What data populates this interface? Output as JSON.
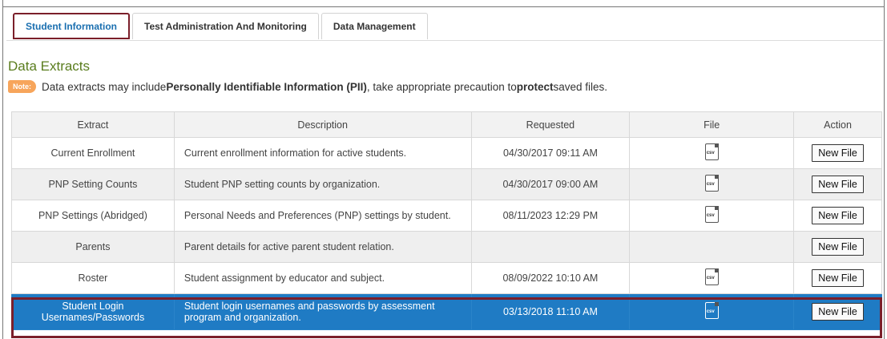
{
  "tabs": [
    {
      "label": "Student Information"
    },
    {
      "label": "Test Administration And Monitoring"
    },
    {
      "label": "Data Management"
    }
  ],
  "section_title": "Data Extracts",
  "note": {
    "badge": "Note:",
    "text_1": "Data extracts may include ",
    "bold_1": "Personally Identifiable Information (PII)",
    "text_2": ", take appropriate precaution to ",
    "bold_2": "protect",
    "text_3": " saved files."
  },
  "table": {
    "headers": {
      "extract": "Extract",
      "description": "Description",
      "requested": "Requested",
      "file": "File",
      "action": "Action"
    },
    "button_label": "New File",
    "file_icon_text": "csv",
    "rows": [
      {
        "extract": "Current Enrollment",
        "description": "Current enrollment information for active students.",
        "requested": "04/30/2017 09:11 AM"
      },
      {
        "extract": "PNP Setting Counts",
        "description": "Student PNP setting counts by organization.",
        "requested": "04/30/2017 09:00 AM"
      },
      {
        "extract": "PNP Settings (Abridged)",
        "description": "Personal Needs and Preferences (PNP) settings by student.",
        "requested": "08/11/2023 12:29 PM"
      },
      {
        "extract": "Parents",
        "description": "Parent details for active parent student relation.",
        "requested": ""
      },
      {
        "extract": "Roster",
        "description": "Student assignment by educator and subject.",
        "requested": "08/09/2022 10:10 AM"
      },
      {
        "extract_l1": "Student Login",
        "extract_l2": "Usernames/Passwords",
        "description_l1": "Student login usernames and passwords by assessment",
        "description_l2": "program and organization.",
        "requested": "03/13/2018 11:10 AM"
      }
    ]
  }
}
